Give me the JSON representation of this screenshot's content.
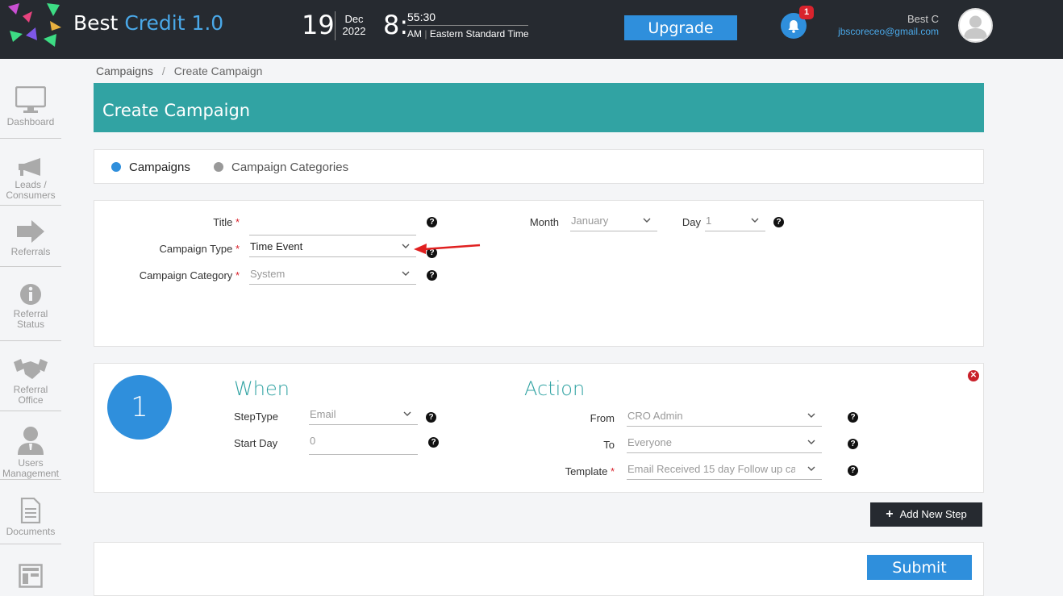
{
  "app": {
    "brand_prefix": "Best",
    "brand_accent": "Credit 1.0",
    "accent_color": "#31a3a3",
    "primary_color": "#2f8fdc"
  },
  "header": {
    "date_day": "19",
    "date_month": "Dec",
    "date_year": "2022",
    "time_hour": "8:",
    "time_minsec": "55:30",
    "time_ampm": "AM",
    "time_zone": "Eastern Standard Time",
    "upgrade_label": "Upgrade",
    "notification_count": "1",
    "user_name": "Best C",
    "user_email": "jbscoreceo@gmail.com"
  },
  "sidebar": {
    "items": [
      {
        "label": "Dashboard",
        "icon": "monitor-icon"
      },
      {
        "label": "Leads / Consumers",
        "icon": "megaphone-icon"
      },
      {
        "label": "Referrals",
        "icon": "arrow-right-icon"
      },
      {
        "label": "Referral Status",
        "icon": "info-icon"
      },
      {
        "label": "Referral Office",
        "icon": "handshake-icon"
      },
      {
        "label": "Users Management",
        "icon": "user-icon"
      },
      {
        "label": "Documents",
        "icon": "document-icon"
      },
      {
        "label": "",
        "icon": "layout-icon"
      }
    ]
  },
  "breadcrumb": {
    "parent": "Campaigns",
    "separator": "/",
    "current": "Create Campaign"
  },
  "page_title": "Create Campaign",
  "tabs": [
    {
      "label": "Campaigns",
      "active": true
    },
    {
      "label": "Campaign Categories",
      "active": false
    }
  ],
  "form": {
    "title_label": "Title",
    "title_value": "",
    "campaign_type_label": "Campaign Type",
    "campaign_type_value": "Time Event",
    "campaign_category_label": "Campaign Category",
    "campaign_category_value": "System",
    "month_label": "Month",
    "month_value": "January",
    "day_label": "Day",
    "day_value": "1",
    "required_mark": "*",
    "help_glyph": "?"
  },
  "step": {
    "number": "1",
    "when_title": "When",
    "action_title": "Action",
    "step_type_label": "StepType",
    "step_type_value": "Email",
    "start_day_label": "Start Day",
    "start_day_value": "0",
    "from_label": "From",
    "from_value": "CRO Admin",
    "to_label": "To",
    "to_value": "Everyone",
    "template_label": "Template",
    "template_value": "Email Received 15 day Follow up ca"
  },
  "actions": {
    "add_step_label": "Add New Step",
    "submit_label": "Submit"
  }
}
